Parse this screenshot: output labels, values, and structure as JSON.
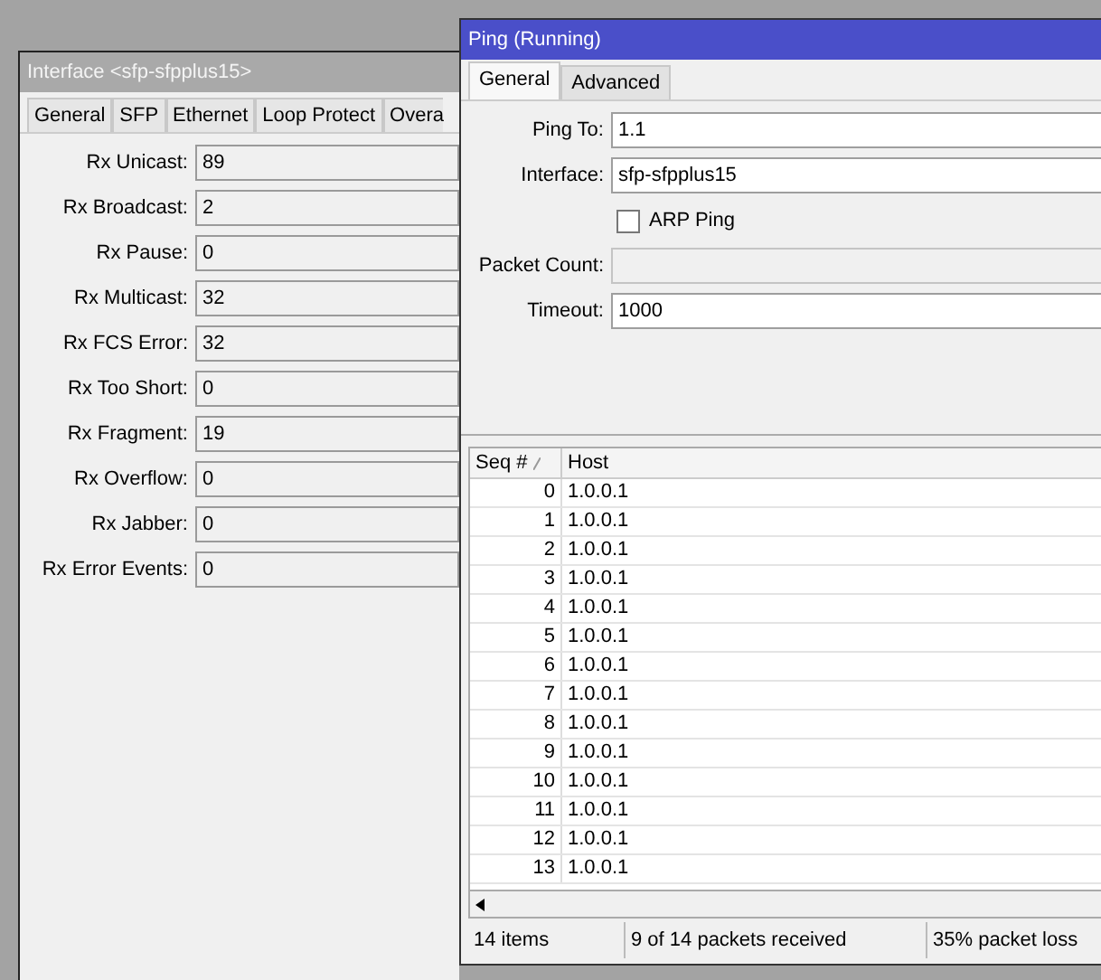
{
  "interface_window": {
    "title": "Interface <sfp-sfpplus15>",
    "tabs": [
      {
        "label": "General"
      },
      {
        "label": "SFP"
      },
      {
        "label": "Ethernet"
      },
      {
        "label": "Loop Protect"
      },
      {
        "label": "Overa"
      }
    ],
    "fields": [
      {
        "label": "Rx Unicast:",
        "value": "89"
      },
      {
        "label": "Rx Broadcast:",
        "value": "2"
      },
      {
        "label": "Rx Pause:",
        "value": "0"
      },
      {
        "label": "Rx Multicast:",
        "value": "32"
      },
      {
        "label": "Rx FCS Error:",
        "value": "32"
      },
      {
        "label": "Rx Too Short:",
        "value": "0"
      },
      {
        "label": "Rx Fragment:",
        "value": "19"
      },
      {
        "label": "Rx Overflow:",
        "value": "0"
      },
      {
        "label": "Rx Jabber:",
        "value": "0"
      },
      {
        "label": "Rx Error Events:",
        "value": "0"
      }
    ]
  },
  "ping_window": {
    "title": "Ping (Running)",
    "tabs": [
      {
        "label": "General",
        "selected": true
      },
      {
        "label": "Advanced",
        "selected": false
      }
    ],
    "fields": [
      {
        "kind": "text",
        "label": "Ping To:",
        "value": "1.1",
        "disabled": false
      },
      {
        "kind": "text",
        "label": "Interface:",
        "value": "sfp-sfpplus15",
        "disabled": false
      },
      {
        "kind": "checkbox",
        "label": "ARP Ping",
        "checked": false
      },
      {
        "kind": "text",
        "label": "Packet Count:",
        "disabled": true
      },
      {
        "kind": "text",
        "label": "Timeout:",
        "value": "1000",
        "disabled": false
      }
    ],
    "table": {
      "columns": [
        "Seq #",
        "Host"
      ],
      "rows": [
        [
          "0",
          "1.0.0.1"
        ],
        [
          "1",
          "1.0.0.1"
        ],
        [
          "2",
          "1.0.0.1"
        ],
        [
          "3",
          "1.0.0.1"
        ],
        [
          "4",
          "1.0.0.1"
        ],
        [
          "5",
          "1.0.0.1"
        ],
        [
          "6",
          "1.0.0.1"
        ],
        [
          "7",
          "1.0.0.1"
        ],
        [
          "8",
          "1.0.0.1"
        ],
        [
          "9",
          "1.0.0.1"
        ],
        [
          "10",
          "1.0.0.1"
        ],
        [
          "11",
          "1.0.0.1"
        ],
        [
          "12",
          "1.0.0.1"
        ],
        [
          "13",
          "1.0.0.1"
        ]
      ]
    },
    "status_bar": [
      "14 items",
      "9 of 14 packets received",
      "35% packet loss"
    ]
  }
}
